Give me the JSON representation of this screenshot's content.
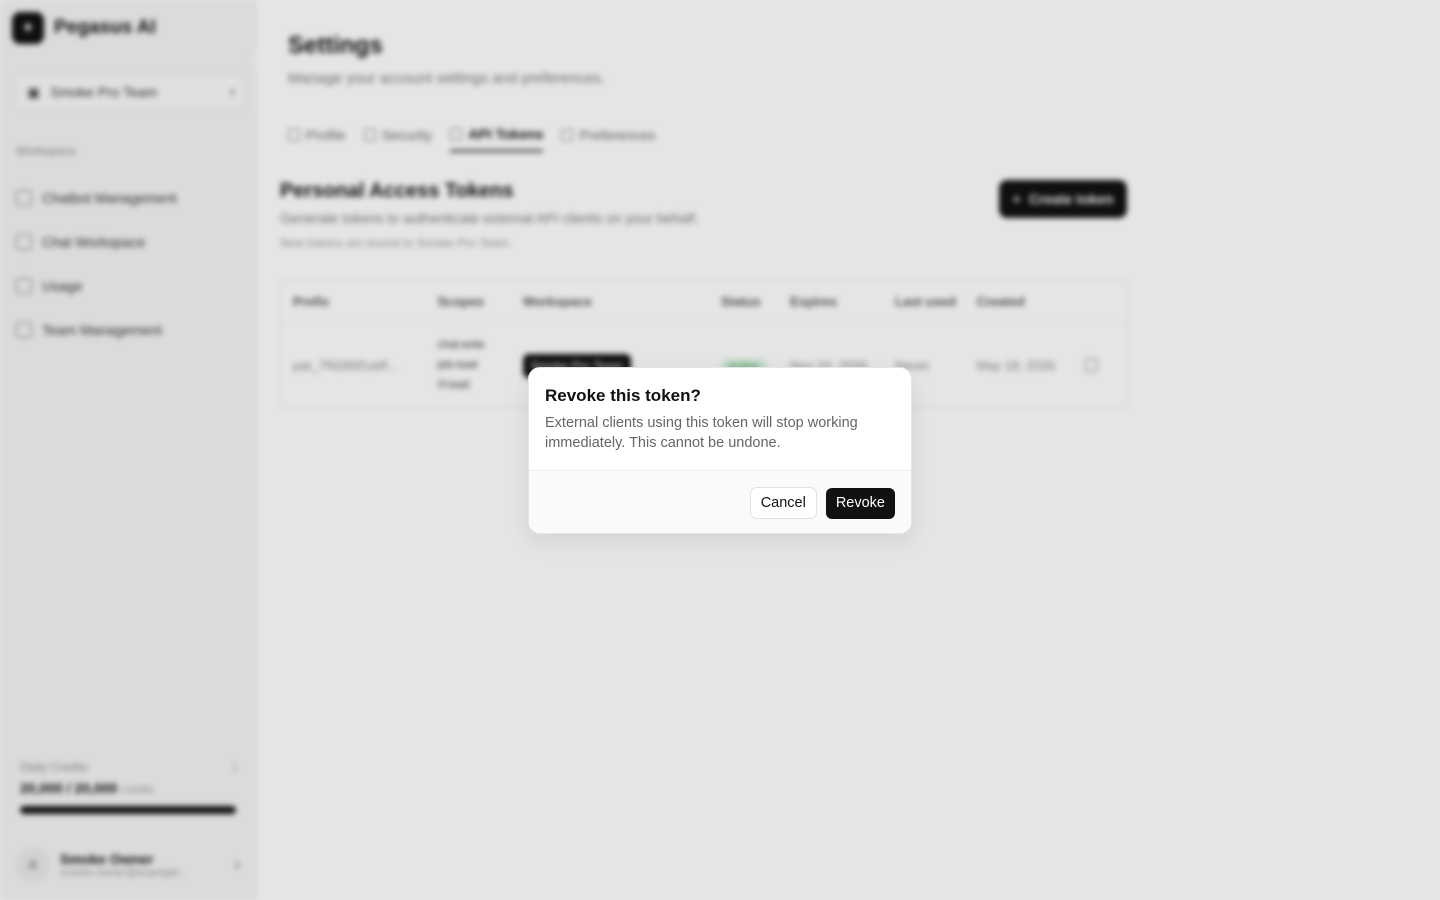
{
  "app": {
    "name": "Pegasus AI"
  },
  "sidebar": {
    "team": "Smoke Pro Team",
    "section_label": "Workspace",
    "items": [
      {
        "label": "Chatbot Management",
        "icon": "bot-icon"
      },
      {
        "label": "Chat Workspace",
        "icon": "chat-icon"
      },
      {
        "label": "Usage",
        "icon": "usage-icon"
      },
      {
        "label": "Team Management",
        "icon": "team-icon"
      }
    ],
    "credits": {
      "label": "Daily Credits",
      "value": "20,000 / 20,000",
      "unit": "credits",
      "fill_fraction": 1.0
    },
    "user": {
      "name": "Smoke Owner",
      "email": "smoke-owner@example...",
      "initial": "A"
    }
  },
  "main": {
    "title": "Settings",
    "subtitle": "Manage your account settings and preferences.",
    "tabs": [
      {
        "label": "Profile",
        "active": false
      },
      {
        "label": "Security",
        "active": false
      },
      {
        "label": "API Tokens",
        "active": true
      },
      {
        "label": "Preferences",
        "active": false
      }
    ],
    "tokens": {
      "title": "Personal Access Tokens",
      "subtitle": "Generate tokens to authenticate external API clients on your behalf.",
      "note": "New tokens are bound to Smoke Pro Team.",
      "create_label": "Create token",
      "columns": [
        "Prefix",
        "Scopes",
        "Workspace",
        "Status",
        "Expires",
        "Last used",
        "Created"
      ],
      "row": {
        "prefix": "pat_7f9286f1a9f...",
        "scopes": [
          "chat:write",
          "job:read",
          "rf:read"
        ],
        "workspace": "Smoke Pro Team",
        "status": "Active",
        "expires": "Nov 15, 2026",
        "last_used": "Never",
        "created": "May 18, 2026"
      }
    }
  },
  "modal": {
    "title": "Revoke this token?",
    "description": "External clients using this token will stop working immediately. This cannot be undone.",
    "cancel_label": "Cancel",
    "confirm_label": "Revoke"
  }
}
